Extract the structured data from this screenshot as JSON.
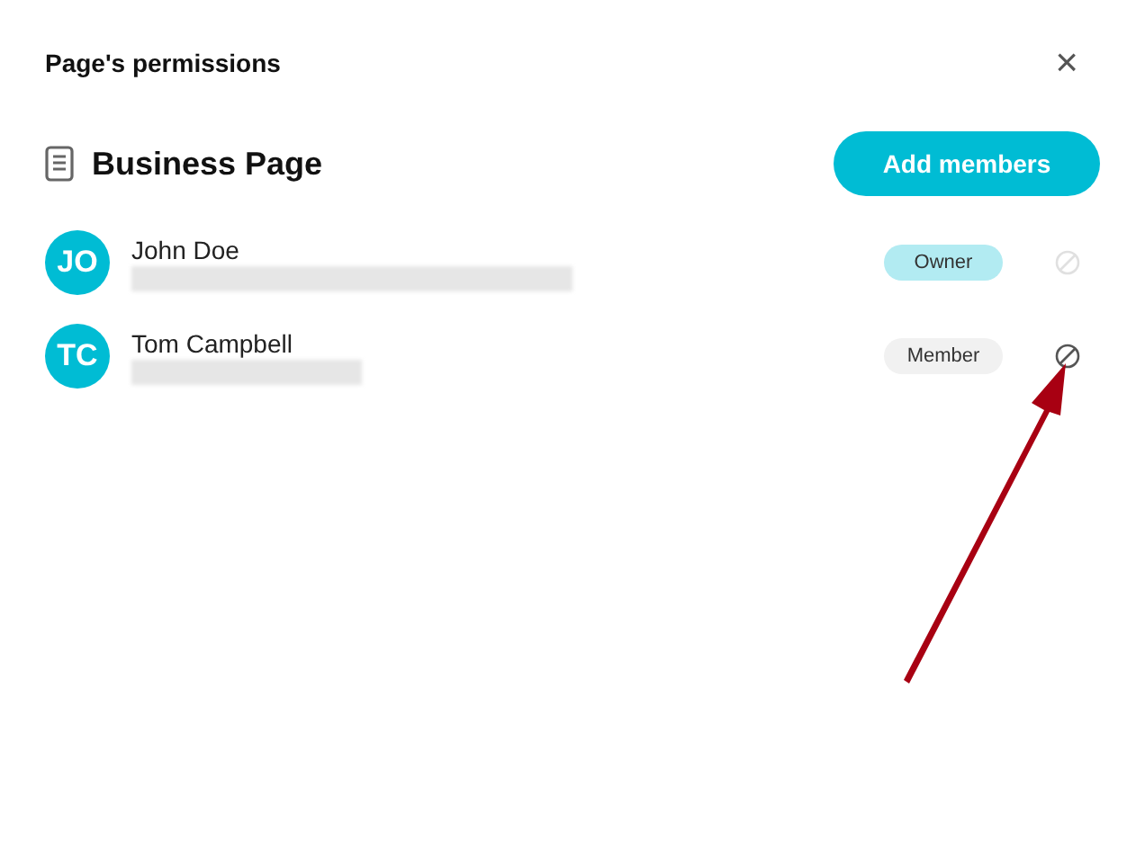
{
  "dialog": {
    "title": "Page's permissions",
    "close": "×"
  },
  "page": {
    "name": "Business Page",
    "add_button": "Add members"
  },
  "members": [
    {
      "initials": "JO",
      "name": "John Doe",
      "role": "Owner",
      "kind": "owner",
      "remove_disabled": true
    },
    {
      "initials": "TC",
      "name": "Tom Campbell",
      "role": "Member",
      "kind": "member",
      "remove_disabled": false
    }
  ]
}
